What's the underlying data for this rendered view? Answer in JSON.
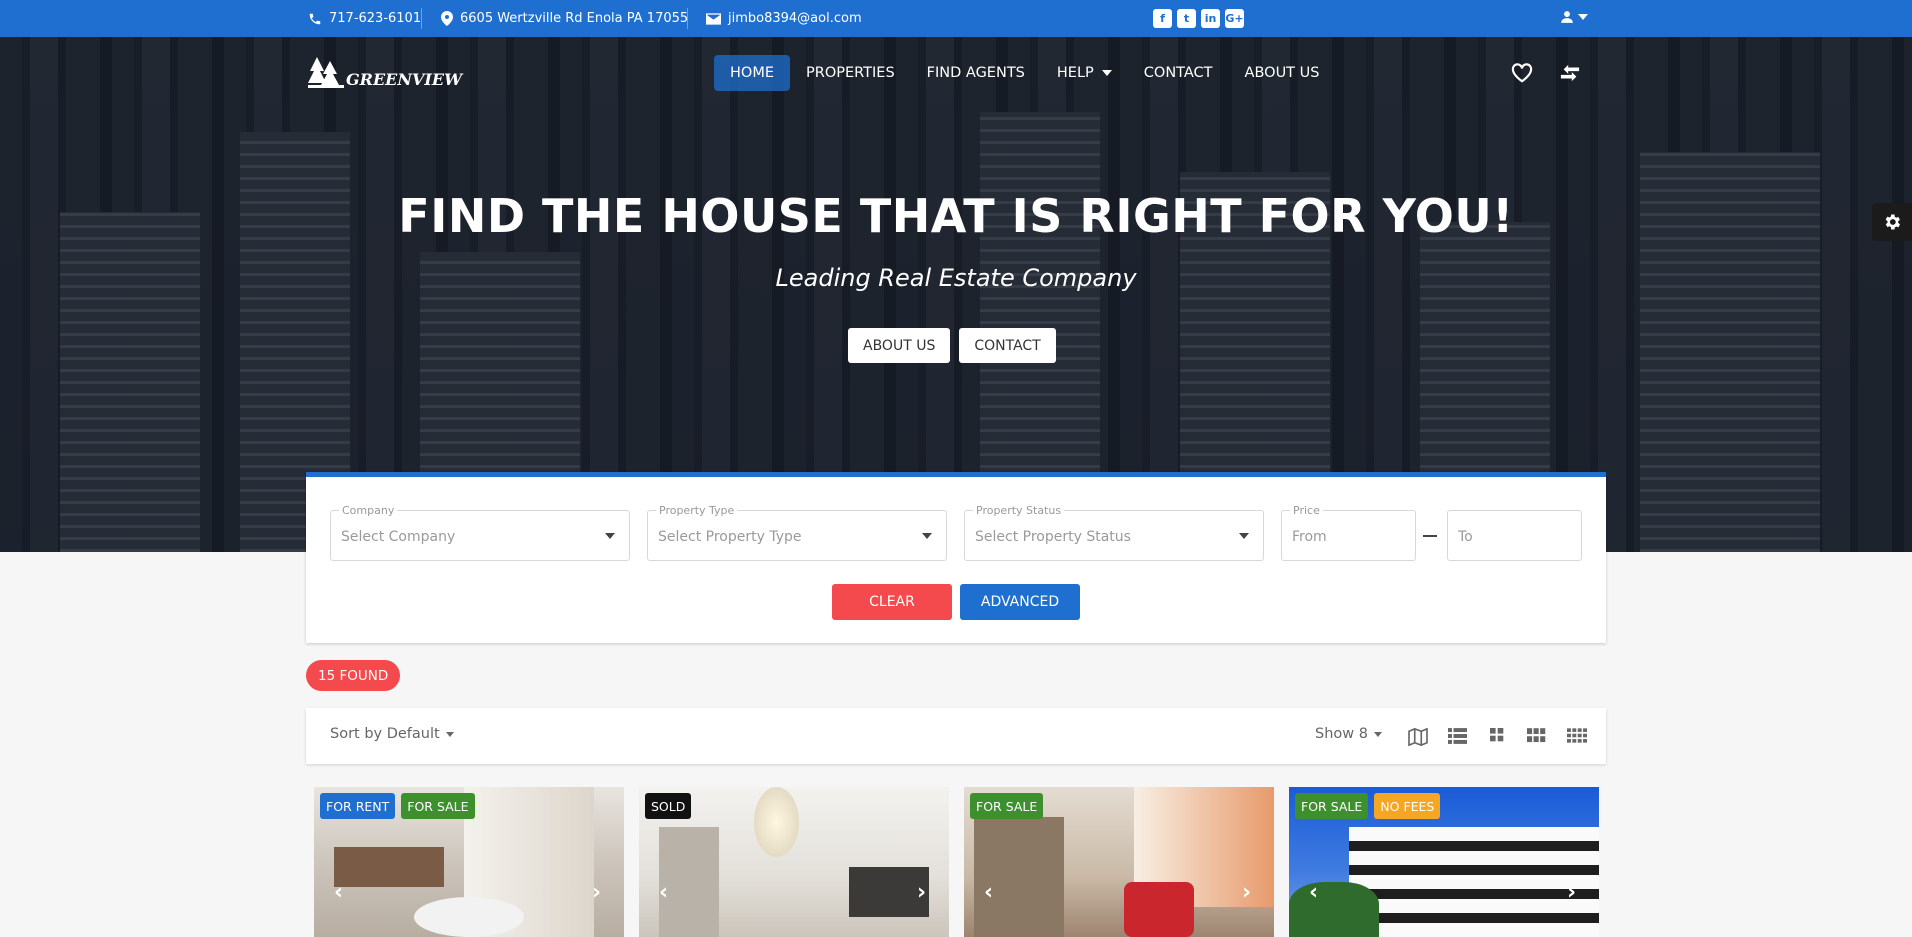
{
  "topbar": {
    "phone": "717-623-6101",
    "address": "6605 Wertzville Rd Enola PA 17055",
    "email": "jimbo8394@aol.com",
    "social": [
      "f",
      "t",
      "in",
      "G+"
    ]
  },
  "brand": {
    "logo_text": "GREENVIEW"
  },
  "nav": {
    "items": [
      {
        "label": "HOME",
        "active": true
      },
      {
        "label": "PROPERTIES"
      },
      {
        "label": "FIND AGENTS"
      },
      {
        "label": "HELP",
        "has_caret": true
      },
      {
        "label": "CONTACT"
      },
      {
        "label": "ABOUT US"
      }
    ]
  },
  "hero": {
    "title": "FIND THE HOUSE THAT IS RIGHT FOR YOU!",
    "subtitle": "Leading Real Estate Company",
    "btn_about": "ABOUT US",
    "btn_contact": "CONTACT"
  },
  "search": {
    "company_label": "Company",
    "company_value": "Select Company",
    "type_label": "Property Type",
    "type_value": "Select Property Type",
    "status_label": "Property Status",
    "status_value": "Select Property Status",
    "price_label": "Price",
    "price_from": "From",
    "price_to": "To",
    "clear": "CLEAR",
    "advanced": "ADVANCED"
  },
  "results": {
    "found": "15 FOUND",
    "sort": "Sort by Default",
    "show": "Show 8"
  },
  "cards": [
    {
      "badges": [
        {
          "text": "FOR RENT",
          "color": "#1f6fd0"
        },
        {
          "text": "FOR SALE",
          "color": "#3e8f2e"
        }
      ]
    },
    {
      "badges": [
        {
          "text": "SOLD",
          "color": "#111111"
        }
      ]
    },
    {
      "badges": [
        {
          "text": "FOR SALE",
          "color": "#3e8f2e"
        }
      ]
    },
    {
      "badges": [
        {
          "text": "FOR SALE",
          "color": "#3e8f2e"
        },
        {
          "text": "NO FEES",
          "color": "#f5a623"
        }
      ]
    }
  ],
  "colors": {
    "primary": "#1f6fd0",
    "danger": "#f4494d"
  }
}
